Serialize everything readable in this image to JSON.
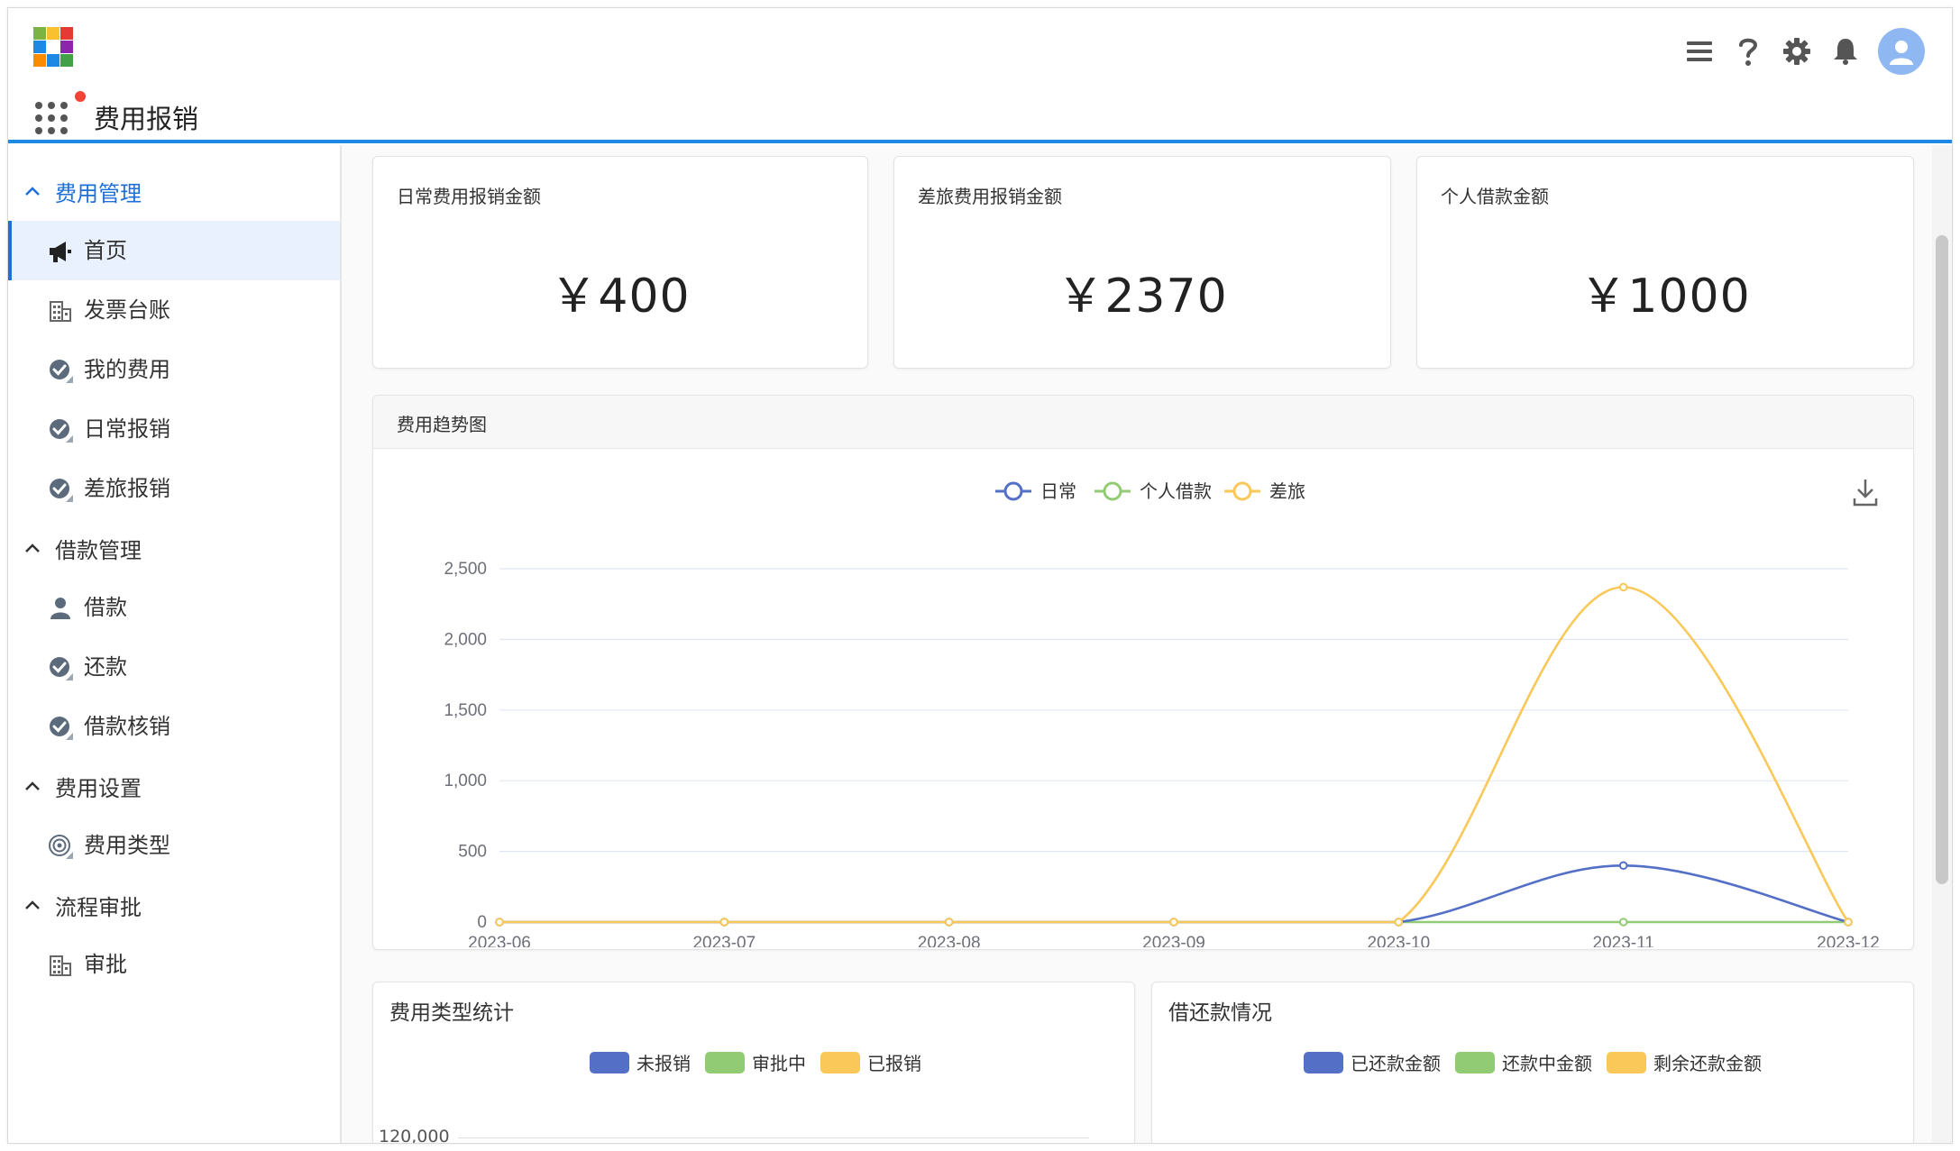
{
  "header": {
    "app_title": "费用报销",
    "logo_colors": [
      "#7cb342",
      "#fbc02d",
      "#e53935",
      "#1e88e5",
      "#ffffff",
      "#8e24aa",
      "#fb8c00",
      "#1e88e5",
      "#43a047"
    ],
    "icons": [
      "menu-icon",
      "help-icon",
      "settings-icon",
      "bell-icon",
      "user-avatar"
    ]
  },
  "sidebar": {
    "groups": [
      {
        "label": "费用管理",
        "expanded": true,
        "active": true,
        "items": [
          {
            "label": "首页",
            "icon": "megaphone-icon",
            "selected": true
          },
          {
            "label": "发票台账",
            "icon": "building-icon"
          },
          {
            "label": "我的费用",
            "icon": "check-badge-icon"
          },
          {
            "label": "日常报销",
            "icon": "check-badge-icon"
          },
          {
            "label": "差旅报销",
            "icon": "check-badge-icon"
          }
        ]
      },
      {
        "label": "借款管理",
        "expanded": true,
        "items": [
          {
            "label": "借款",
            "icon": "person-icon"
          },
          {
            "label": "还款",
            "icon": "check-badge-icon"
          },
          {
            "label": "借款核销",
            "icon": "check-badge-icon"
          }
        ]
      },
      {
        "label": "费用设置",
        "expanded": true,
        "items": [
          {
            "label": "费用类型",
            "icon": "target-icon"
          }
        ]
      },
      {
        "label": "流程审批",
        "expanded": true,
        "items": [
          {
            "label": "审批",
            "icon": "building-icon"
          }
        ]
      }
    ]
  },
  "kpis": [
    {
      "title": "日常费用报销金额",
      "value": "￥400"
    },
    {
      "title": "差旅费用报销金额",
      "value": "￥2370"
    },
    {
      "title": "个人借款金额",
      "value": "￥1000"
    }
  ],
  "trend_panel": {
    "title": "费用趋势图"
  },
  "expense_type_panel": {
    "title": "费用类型统计",
    "legend": [
      {
        "label": "未报销",
        "color": "#5470c6"
      },
      {
        "label": "审批中",
        "color": "#91cc75"
      },
      {
        "label": "已报销",
        "color": "#fac858"
      }
    ],
    "y_tick_visible": "120,000"
  },
  "loan_panel": {
    "title": "借还款情况",
    "legend": [
      {
        "label": "已还款金额",
        "color": "#5470c6"
      },
      {
        "label": "还款中金额",
        "color": "#91cc75"
      },
      {
        "label": "剩余还款金额",
        "color": "#fac858"
      }
    ]
  },
  "chart_data": {
    "type": "line",
    "title": "",
    "x": [
      "2023-06",
      "2023-07",
      "2023-08",
      "2023-09",
      "2023-10",
      "2023-11",
      "2023-12"
    ],
    "series": [
      {
        "name": "日常",
        "color": "#5470c6",
        "values": [
          0,
          0,
          0,
          0,
          0,
          400,
          0
        ]
      },
      {
        "name": "个人借款",
        "color": "#91cc75",
        "values": [
          0,
          0,
          0,
          0,
          0,
          0,
          0
        ]
      },
      {
        "name": "差旅",
        "color": "#fac858",
        "values": [
          0,
          0,
          0,
          0,
          0,
          2370,
          0
        ]
      }
    ],
    "ylim": [
      0,
      2500
    ],
    "yticks": [
      "0",
      "500",
      "1,000",
      "1,500",
      "2,000",
      "2,500"
    ],
    "grid": true,
    "legend_position": "top-center",
    "smooth": true
  }
}
